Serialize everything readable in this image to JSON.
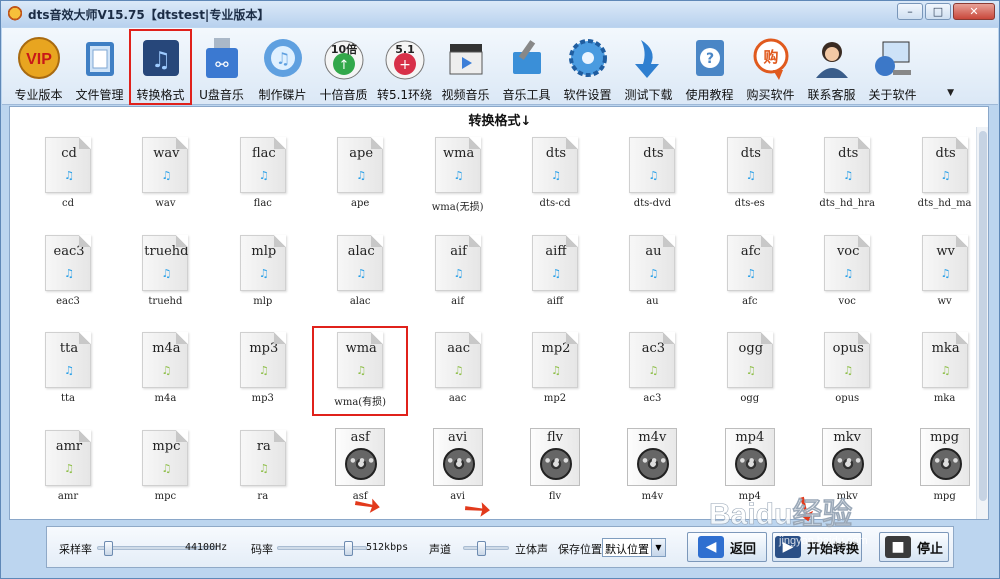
{
  "window": {
    "title": "dts音效大师V15.75【dtstest|专业版本】",
    "controls": [
      "–",
      "□",
      "✕"
    ]
  },
  "toolbar": {
    "items": [
      {
        "label": "专业版本",
        "icon": "vip-icon",
        "color": "#e8a520"
      },
      {
        "label": "文件管理",
        "icon": "folder-icon",
        "color": "#3f7fc4"
      },
      {
        "label": "转换格式",
        "icon": "music-note-icon",
        "color": "#27477a",
        "selected": true
      },
      {
        "label": "U盘音乐",
        "icon": "usb-icon",
        "color": "#3b79d1"
      },
      {
        "label": "制作碟片",
        "icon": "ipod-icon",
        "color": "#5fa0e0"
      },
      {
        "label": "十倍音质",
        "icon": "ten-times-icon",
        "color": "#33a84a",
        "badge": "10倍"
      },
      {
        "label": "转5.1环绕",
        "icon": "surround-51-icon",
        "color": "#d83048",
        "badge": "5.1"
      },
      {
        "label": "视频音乐",
        "icon": "clapperboard-icon",
        "color": "#333"
      },
      {
        "label": "音乐工具",
        "icon": "wrench-icon",
        "color": "#3a8fd8"
      },
      {
        "label": "软件设置",
        "icon": "gear-icon",
        "color": "#4a9be0"
      },
      {
        "label": "测试下载",
        "icon": "download-arrow-icon",
        "color": "#2f7fd0"
      },
      {
        "label": "使用教程",
        "icon": "help-book-icon",
        "color": "#4a86c6"
      },
      {
        "label": "购买软件",
        "icon": "buy-icon",
        "color": "#e05a1e",
        "badge": "购"
      },
      {
        "label": "联系客服",
        "icon": "support-headset-icon",
        "color": "#3a5d8a"
      },
      {
        "label": "关于软件",
        "icon": "computer-globe-icon",
        "color": "#3c78c8"
      }
    ]
  },
  "panel": {
    "title": "转换格式↓",
    "items": [
      {
        "ext": "cd",
        "caption": "cd",
        "kind": "audio"
      },
      {
        "ext": "wav",
        "caption": "wav",
        "kind": "audio"
      },
      {
        "ext": "flac",
        "caption": "flac",
        "kind": "audio"
      },
      {
        "ext": "ape",
        "caption": "ape",
        "kind": "audio"
      },
      {
        "ext": "wma",
        "caption": "wma(无损)",
        "kind": "audio"
      },
      {
        "ext": "dts",
        "caption": "dts-cd",
        "kind": "audio"
      },
      {
        "ext": "dts",
        "caption": "dts-dvd",
        "kind": "audio"
      },
      {
        "ext": "dts",
        "caption": "dts-es",
        "kind": "audio"
      },
      {
        "ext": "dts",
        "caption": "dts_hd_hra",
        "kind": "audio"
      },
      {
        "ext": "dts",
        "caption": "dts_hd_ma",
        "kind": "audio"
      },
      {
        "ext": "eac3",
        "caption": "eac3",
        "kind": "audio"
      },
      {
        "ext": "truehd",
        "caption": "truehd",
        "kind": "audio"
      },
      {
        "ext": "mlp",
        "caption": "mlp",
        "kind": "audio"
      },
      {
        "ext": "alac",
        "caption": "alac",
        "kind": "audio"
      },
      {
        "ext": "aif",
        "caption": "aif",
        "kind": "audio"
      },
      {
        "ext": "aiff",
        "caption": "aiff",
        "kind": "audio"
      },
      {
        "ext": "au",
        "caption": "au",
        "kind": "audio"
      },
      {
        "ext": "afc",
        "caption": "afc",
        "kind": "audio"
      },
      {
        "ext": "voc",
        "caption": "voc",
        "kind": "audio"
      },
      {
        "ext": "wv",
        "caption": "wv",
        "kind": "audio"
      },
      {
        "ext": "tta",
        "caption": "tta",
        "kind": "audio"
      },
      {
        "ext": "m4a",
        "caption": "m4a",
        "kind": "lossy"
      },
      {
        "ext": "mp3",
        "caption": "mp3",
        "kind": "lossy"
      },
      {
        "ext": "wma",
        "caption": "wma(有损)",
        "kind": "lossy",
        "highlight": true
      },
      {
        "ext": "aac",
        "caption": "aac",
        "kind": "lossy"
      },
      {
        "ext": "mp2",
        "caption": "mp2",
        "kind": "lossy"
      },
      {
        "ext": "ac3",
        "caption": "ac3",
        "kind": "lossy"
      },
      {
        "ext": "ogg",
        "caption": "ogg",
        "kind": "lossy"
      },
      {
        "ext": "opus",
        "caption": "opus",
        "kind": "lossy"
      },
      {
        "ext": "mka",
        "caption": "mka",
        "kind": "lossy"
      },
      {
        "ext": "amr",
        "caption": "amr",
        "kind": "lossy"
      },
      {
        "ext": "mpc",
        "caption": "mpc",
        "kind": "lossy"
      },
      {
        "ext": "ra",
        "caption": "ra",
        "kind": "lossy"
      },
      {
        "ext": "asf",
        "caption": "asf",
        "kind": "video"
      },
      {
        "ext": "avi",
        "caption": "avi",
        "kind": "video"
      },
      {
        "ext": "flv",
        "caption": "flv",
        "kind": "video"
      },
      {
        "ext": "m4v",
        "caption": "m4v",
        "kind": "video"
      },
      {
        "ext": "mp4",
        "caption": "mp4",
        "kind": "video"
      },
      {
        "ext": "mkv",
        "caption": "mkv",
        "kind": "video"
      },
      {
        "ext": "mpg",
        "caption": "mpg",
        "kind": "video"
      }
    ]
  },
  "settings": {
    "sample_rate_label": "采样率",
    "sample_rate_value": "44100Hz",
    "sample_rate_level": 0.05,
    "bitrate_label": "码率",
    "bitrate_value": "512kbps",
    "bitrate_level": 0.82,
    "channel_label": "声道",
    "channel_value": "立体声",
    "channel_level": 0.35,
    "save_label": "保存位置",
    "save_value": "默认位置",
    "back_label": "返回",
    "start_label": "开始转换",
    "stop_label": "停止"
  },
  "watermark": {
    "text": "Baidu经验",
    "sub": "jingyan.baidu.com"
  }
}
